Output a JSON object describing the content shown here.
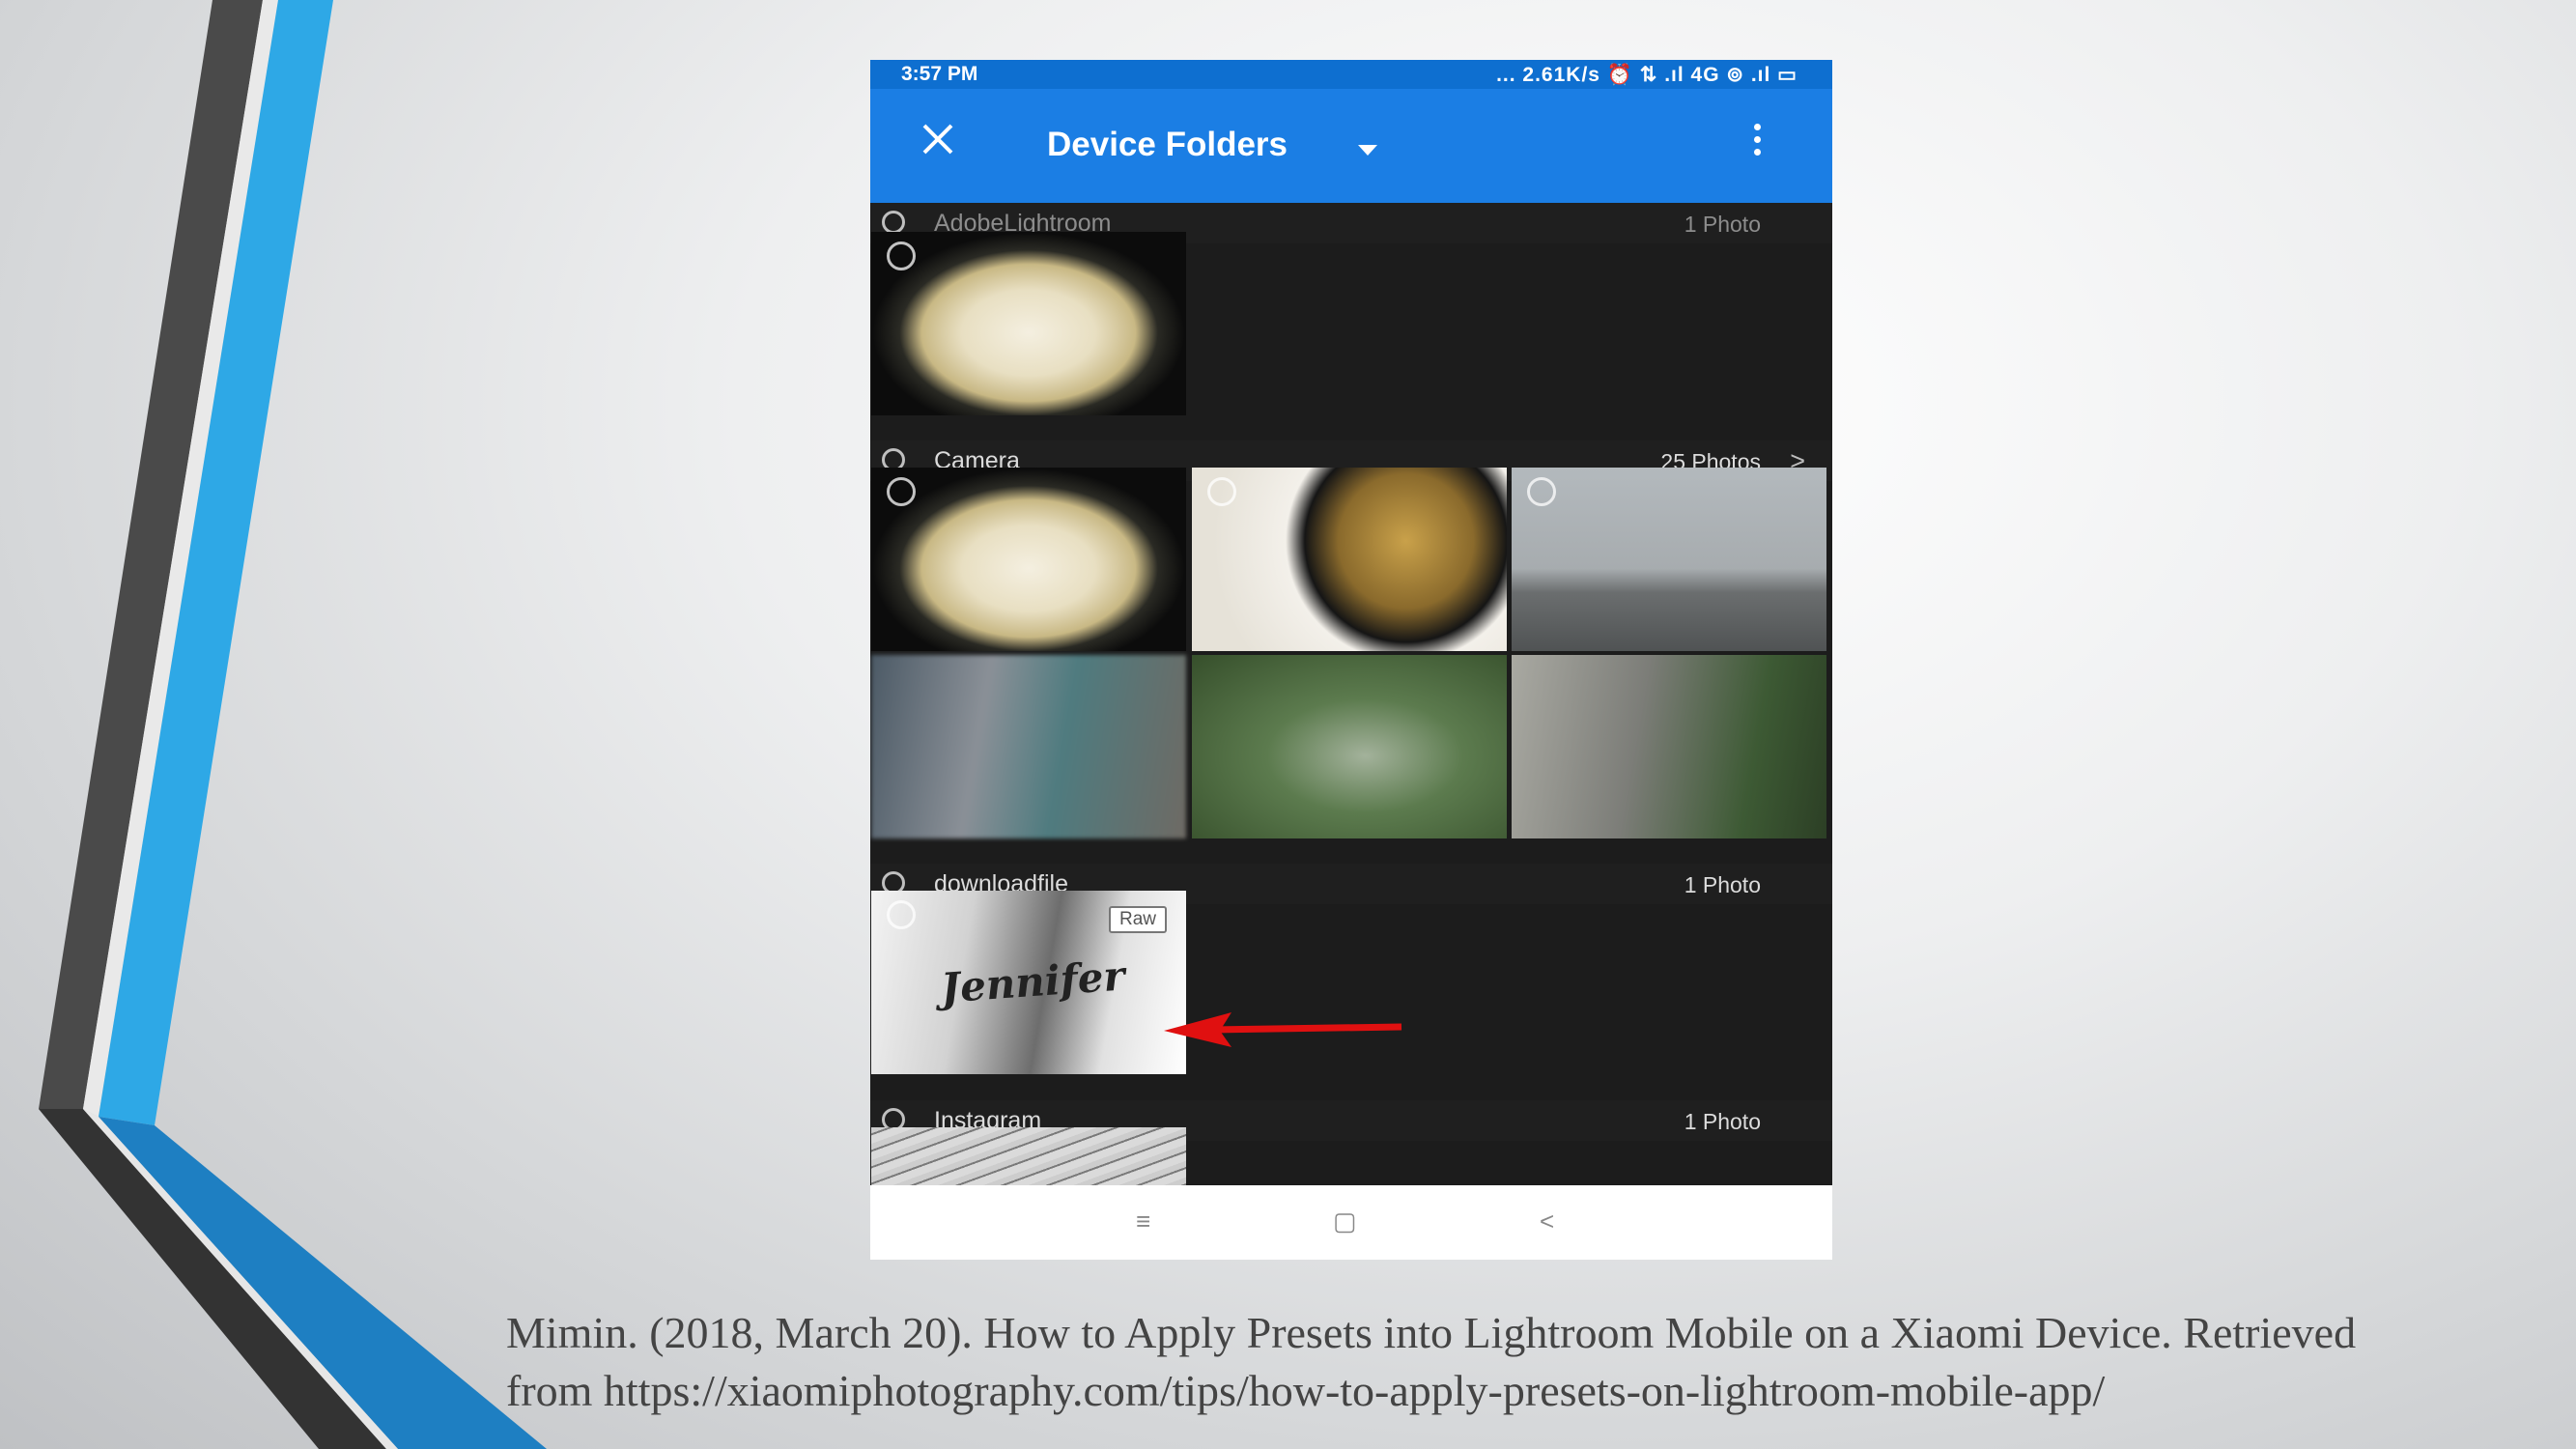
{
  "status_bar": {
    "time": "3:57 PM",
    "indicators": "... 2.61K/s ⏰ ⇅ .ıl 4G ⊚ .ıl ▭"
  },
  "app_bar": {
    "close_icon": "close-icon",
    "title": "Device Folders",
    "more_icon": "more-vert-icon"
  },
  "folders": [
    {
      "name": "AdobeLightroom",
      "count": "1 Photo",
      "has_chevron": false
    },
    {
      "name": "Camera",
      "count": "25 Photos",
      "has_chevron": true
    },
    {
      "name": "downloadfile",
      "count": "1 Photo",
      "has_chevron": false
    },
    {
      "name": "Instagram",
      "count": "1 Photo",
      "has_chevron": false
    }
  ],
  "download_thumb": {
    "badge": "Raw",
    "overlay_text": "Jennifer"
  },
  "annotation": {
    "arrow_color": "#e01010"
  },
  "nav_bar": {
    "menu_icon": "≡",
    "home_icon": "▢",
    "back_icon": "<"
  },
  "citation": {
    "line1": "Mimin. (2018, March 20). How to Apply Presets into Lightroom Mobile on a Xiaomi Device. Retrieved",
    "line2": "from https://xiaomiphotography.com/tips/how-to-apply-presets-on-lightroom-mobile-app/"
  },
  "colors": {
    "accent_blue": "#1b7ee4",
    "deco_light_blue": "#2ea8e6",
    "deco_dark": "#4a4a4a"
  }
}
